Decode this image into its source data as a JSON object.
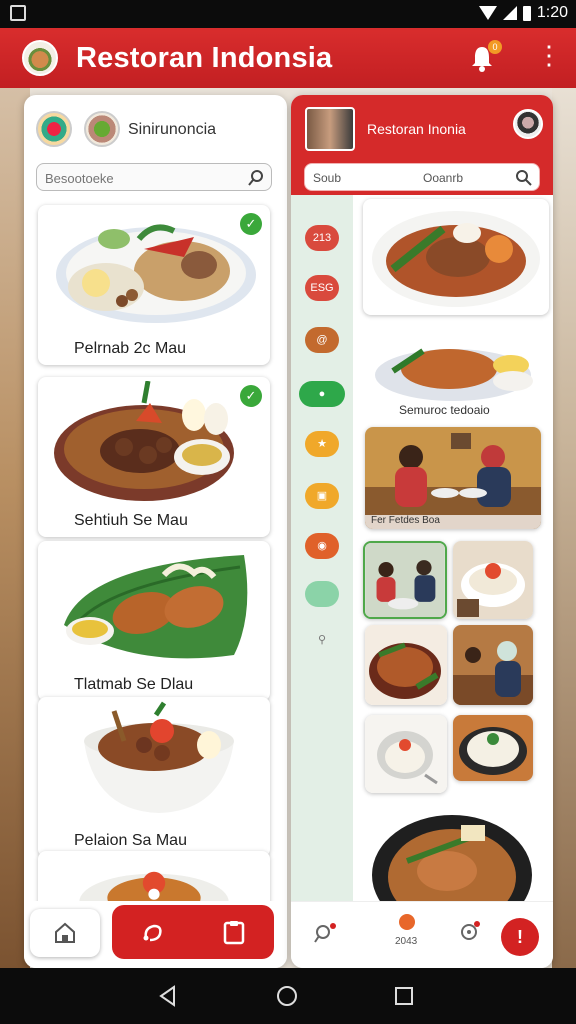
{
  "status_bar": {
    "time": "1:20"
  },
  "app_bar": {
    "title": "Restoran Indonsia",
    "notification_count": "0"
  },
  "left_panel": {
    "title": "Sinirunoncia",
    "search": {
      "placeholder": "Besootoeke"
    },
    "items": [
      {
        "label": "Pelrnab 2c Mau",
        "checked": true
      },
      {
        "label": "Sehtiuh Se Mau",
        "checked": true
      },
      {
        "label": "Tlatmab Se Dlau",
        "checked": false
      },
      {
        "label": "Pelaion Sa Mau",
        "checked": false
      }
    ]
  },
  "right_panel": {
    "title": "Restoran Inonia",
    "search": {
      "left_text": "Soub",
      "right_text": "Ooanrb"
    },
    "rail": [
      {
        "icon": "menu-chip-icon",
        "label": "213",
        "color": "#d94a3d"
      },
      {
        "icon": "menu-chip-icon",
        "label": "ESG",
        "color": "#d94a3d"
      },
      {
        "icon": "spiral-icon",
        "label": "",
        "color": "#c36a2e"
      },
      {
        "icon": "toggle-pill-icon",
        "label": "",
        "color": "#2ea84a"
      },
      {
        "icon": "star-chip-icon",
        "label": "",
        "color": "#f0a82a"
      },
      {
        "icon": "bag-chip-icon",
        "label": "",
        "color": "#f0a82a"
      },
      {
        "icon": "coin-chip-icon",
        "label": "",
        "color": "#e0612a"
      },
      {
        "icon": "leaf-chip-icon",
        "label": "",
        "color": "#8bd3a8"
      },
      {
        "icon": "wrench-icon",
        "label": "",
        "color": "#777777"
      }
    ],
    "caption_1": "Semuroc tedoaio",
    "caption_2": "Fer Fetdes Boa",
    "bottom_label": "2043"
  },
  "colors": {
    "brand_red": "#d32222",
    "check_green": "#3aa83a",
    "rail_bg": "#e3efe6"
  }
}
